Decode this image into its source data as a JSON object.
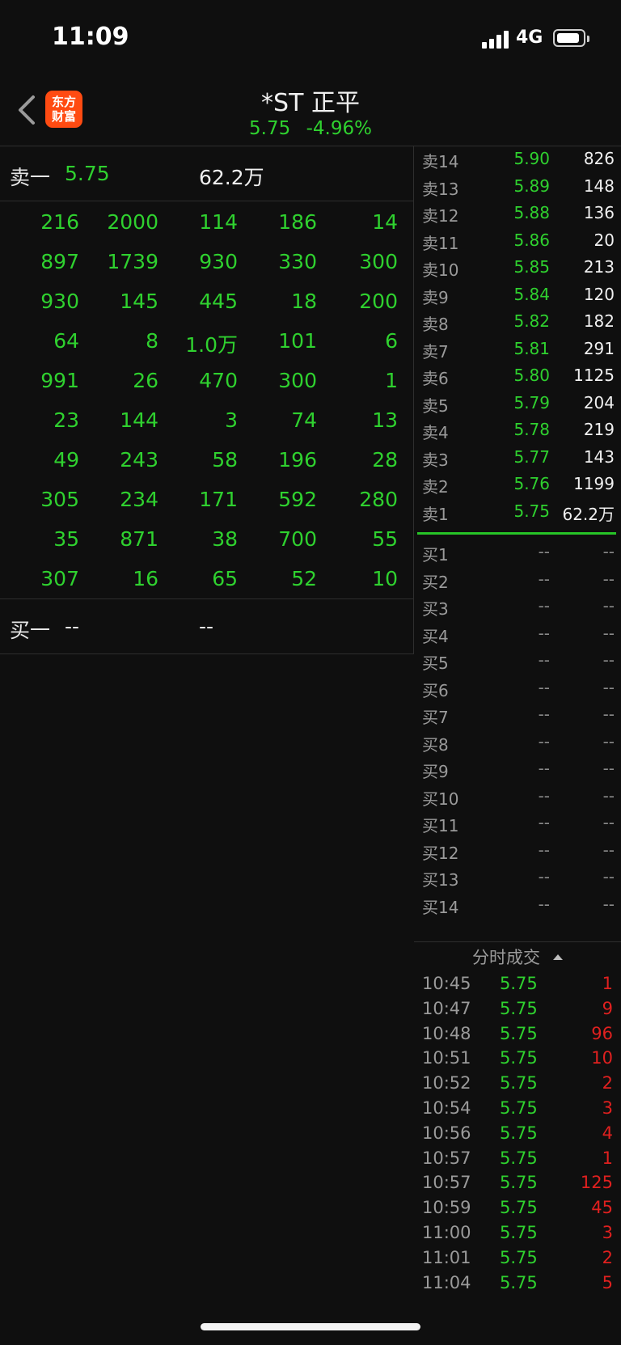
{
  "status": {
    "time": "11:09",
    "network": "4G"
  },
  "header": {
    "logo_line1": "东方",
    "logo_line2": "财富",
    "title": "*ST 正平",
    "price": "5.75",
    "change": "-4.96%"
  },
  "left": {
    "sell_one": {
      "label": "卖一",
      "price": "5.75",
      "volume": "62.2万"
    },
    "rows": [
      [
        "216",
        "2000",
        "114",
        "186",
        "14"
      ],
      [
        "897",
        "1739",
        "930",
        "330",
        "300"
      ],
      [
        "930",
        "145",
        "445",
        "18",
        "200"
      ],
      [
        "64",
        "8",
        "1.0万",
        "101",
        "6"
      ],
      [
        "991",
        "26",
        "470",
        "300",
        "1"
      ],
      [
        "23",
        "144",
        "3",
        "74",
        "13"
      ],
      [
        "49",
        "243",
        "58",
        "196",
        "28"
      ],
      [
        "305",
        "234",
        "171",
        "592",
        "280"
      ],
      [
        "35",
        "871",
        "38",
        "700",
        "55"
      ],
      [
        "307",
        "16",
        "65",
        "52",
        "10"
      ]
    ],
    "buy_one": {
      "label": "买一",
      "price": "--",
      "volume": "--"
    }
  },
  "sell_levels": [
    {
      "label": "卖14",
      "price": "5.90",
      "volume": "826"
    },
    {
      "label": "卖13",
      "price": "5.89",
      "volume": "148"
    },
    {
      "label": "卖12",
      "price": "5.88",
      "volume": "136"
    },
    {
      "label": "卖11",
      "price": "5.86",
      "volume": "20"
    },
    {
      "label": "卖10",
      "price": "5.85",
      "volume": "213"
    },
    {
      "label": "卖9",
      "price": "5.84",
      "volume": "120"
    },
    {
      "label": "卖8",
      "price": "5.82",
      "volume": "182"
    },
    {
      "label": "卖7",
      "price": "5.81",
      "volume": "291"
    },
    {
      "label": "卖6",
      "price": "5.80",
      "volume": "1125"
    },
    {
      "label": "卖5",
      "price": "5.79",
      "volume": "204"
    },
    {
      "label": "卖4",
      "price": "5.78",
      "volume": "219"
    },
    {
      "label": "卖3",
      "price": "5.77",
      "volume": "143"
    },
    {
      "label": "卖2",
      "price": "5.76",
      "volume": "1199"
    },
    {
      "label": "卖1",
      "price": "5.75",
      "volume": "62.2万"
    }
  ],
  "buy_levels": [
    {
      "label": "买1",
      "price": "--",
      "volume": "--"
    },
    {
      "label": "买2",
      "price": "--",
      "volume": "--"
    },
    {
      "label": "买3",
      "price": "--",
      "volume": "--"
    },
    {
      "label": "买4",
      "price": "--",
      "volume": "--"
    },
    {
      "label": "买5",
      "price": "--",
      "volume": "--"
    },
    {
      "label": "买6",
      "price": "--",
      "volume": "--"
    },
    {
      "label": "买7",
      "price": "--",
      "volume": "--"
    },
    {
      "label": "买8",
      "price": "--",
      "volume": "--"
    },
    {
      "label": "买9",
      "price": "--",
      "volume": "--"
    },
    {
      "label": "买10",
      "price": "--",
      "volume": "--"
    },
    {
      "label": "买11",
      "price": "--",
      "volume": "--"
    },
    {
      "label": "买12",
      "price": "--",
      "volume": "--"
    },
    {
      "label": "买13",
      "price": "--",
      "volume": "--"
    },
    {
      "label": "买14",
      "price": "--",
      "volume": "--"
    }
  ],
  "ticks": {
    "title": "分时成交",
    "rows": [
      {
        "time": "10:45",
        "price": "5.75",
        "volume": "1"
      },
      {
        "time": "10:47",
        "price": "5.75",
        "volume": "9"
      },
      {
        "time": "10:48",
        "price": "5.75",
        "volume": "96"
      },
      {
        "time": "10:51",
        "price": "5.75",
        "volume": "10"
      },
      {
        "time": "10:52",
        "price": "5.75",
        "volume": "2"
      },
      {
        "time": "10:54",
        "price": "5.75",
        "volume": "3"
      },
      {
        "time": "10:56",
        "price": "5.75",
        "volume": "4"
      },
      {
        "time": "10:57",
        "price": "5.75",
        "volume": "1"
      },
      {
        "time": "10:57",
        "price": "5.75",
        "volume": "125"
      },
      {
        "time": "10:59",
        "price": "5.75",
        "volume": "45"
      },
      {
        "time": "11:00",
        "price": "5.75",
        "volume": "3"
      },
      {
        "time": "11:01",
        "price": "5.75",
        "volume": "2"
      },
      {
        "time": "11:04",
        "price": "5.75",
        "volume": "5"
      }
    ]
  },
  "colors": {
    "up": "#e0201f",
    "down": "#2fd12f",
    "accent": "#ff4b12"
  }
}
